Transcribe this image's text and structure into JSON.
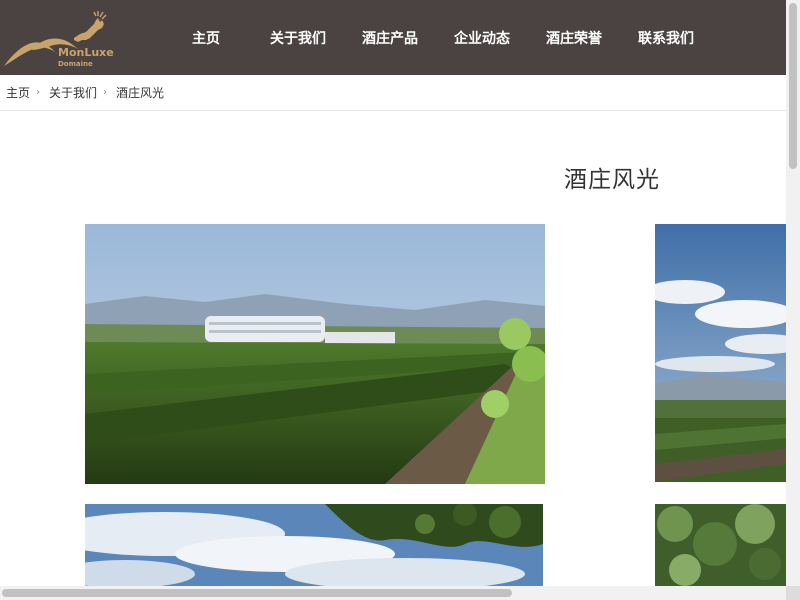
{
  "logo": {
    "name": "MonLuxe",
    "sub": "Domaine"
  },
  "nav": {
    "items": [
      {
        "label": "主页"
      },
      {
        "label": "关于我们"
      },
      {
        "label": "酒庄产品"
      },
      {
        "label": "企业动态"
      },
      {
        "label": "酒庄荣誉"
      },
      {
        "label": "联系我们"
      }
    ]
  },
  "breadcrumb": {
    "items": [
      {
        "label": "主页"
      },
      {
        "label": "关于我们"
      },
      {
        "label": "酒庄风光"
      }
    ],
    "separator": "›"
  },
  "page": {
    "title": "酒庄风光"
  },
  "colors": {
    "header_bg": "#4a4341",
    "logo_gold": "#c8a46a",
    "nav_text": "#ffffff"
  },
  "icons": {
    "logo": "deer-logo-icon"
  }
}
